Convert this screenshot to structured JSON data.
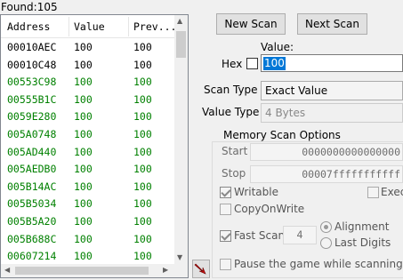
{
  "found_label": "Found:105",
  "results": {
    "columns": [
      "Address",
      "Value",
      "Prev..."
    ],
    "rows": [
      {
        "address": "00010AEC",
        "value": "100",
        "prev": "100",
        "color": "black"
      },
      {
        "address": "00010C48",
        "value": "100",
        "prev": "100",
        "color": "black"
      },
      {
        "address": "00553C98",
        "value": "100",
        "prev": "100",
        "color": "green"
      },
      {
        "address": "00555B1C",
        "value": "100",
        "prev": "100",
        "color": "green"
      },
      {
        "address": "0059E280",
        "value": "100",
        "prev": "100",
        "color": "green"
      },
      {
        "address": "005A0748",
        "value": "100",
        "prev": "100",
        "color": "green"
      },
      {
        "address": "005AD440",
        "value": "100",
        "prev": "100",
        "color": "green"
      },
      {
        "address": "005AEDB0",
        "value": "100",
        "prev": "100",
        "color": "green"
      },
      {
        "address": "005B14AC",
        "value": "100",
        "prev": "100",
        "color": "green"
      },
      {
        "address": "005B5034",
        "value": "100",
        "prev": "100",
        "color": "green"
      },
      {
        "address": "005B5A20",
        "value": "100",
        "prev": "100",
        "color": "green"
      },
      {
        "address": "005B688C",
        "value": "100",
        "prev": "100",
        "color": "green"
      },
      {
        "address": "00607214",
        "value": "100",
        "prev": "100",
        "color": "green"
      }
    ]
  },
  "buttons": {
    "new_scan": "New Scan",
    "next_scan": "Next Scan"
  },
  "value": {
    "label": "Value:",
    "hex_label": "Hex",
    "current": "100"
  },
  "scan_type": {
    "label": "Scan Type",
    "selected": "Exact Value"
  },
  "value_type": {
    "label": "Value Type",
    "selected": "4 Bytes"
  },
  "memory_options": {
    "title": "Memory Scan Options",
    "start_label": "Start",
    "start_value": "0000000000000000",
    "stop_label": "Stop",
    "stop_value": "00007fffffffffff",
    "writable": "Writable",
    "executable": "Execu",
    "copy_on_write": "CopyOnWrite",
    "fast_scan": "Fast Scan",
    "fast_scan_value": "4",
    "alignment": "Alignment",
    "last_digits": "Last Digits",
    "pause": "Pause the game while scanning"
  },
  "colors": {
    "green": "#008000",
    "black": "#000000",
    "selection": "#0078d7"
  }
}
